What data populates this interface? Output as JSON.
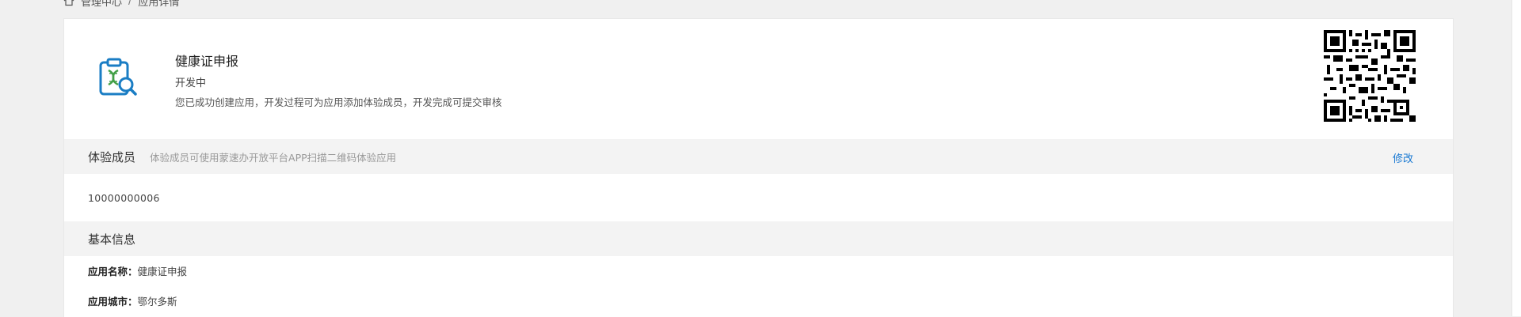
{
  "breadcrumb": {
    "home_icon": "home-icon",
    "items": [
      "管理中心",
      "应用详情"
    ],
    "separator": "/"
  },
  "app": {
    "name": "健康证申报",
    "status": "开发中",
    "description": "您已成功创建应用，开发过程可为应用添加体验成员，开发完成可提交审核",
    "icon": "app-dna-search-icon",
    "qr_icon": "qr-code"
  },
  "members_section": {
    "title": "体验成员",
    "hint": "体验成员可使用蒙速办开放平台APP扫描二维码体验应用",
    "edit_label": "修改",
    "members": [
      "10000000006"
    ]
  },
  "basic_info": {
    "title": "基本信息",
    "rows": [
      {
        "label": "应用名称：",
        "value": "健康证申报"
      },
      {
        "label": "应用城市：",
        "value": "鄂尔多斯"
      }
    ]
  },
  "colors": {
    "accent": "#1677d2",
    "section_bg": "#f3f3f3",
    "page_bg": "#f0f0f0"
  }
}
